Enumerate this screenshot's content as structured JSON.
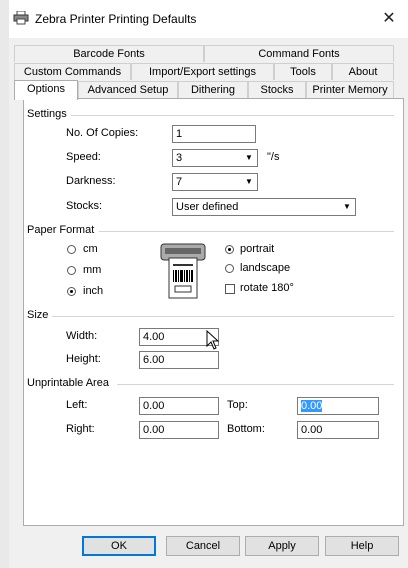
{
  "window": {
    "title": "Zebra Printer Printing Defaults"
  },
  "tabs": {
    "row1": [
      "Barcode Fonts",
      "Command Fonts"
    ],
    "row2": [
      "Custom Commands",
      "Import/Export settings",
      "Tools",
      "About"
    ],
    "row3": [
      "Options",
      "Advanced Setup",
      "Dithering",
      "Stocks",
      "Printer Memory"
    ],
    "active": "Options"
  },
  "settings": {
    "heading": "Settings",
    "copies_label": "No. Of Copies:",
    "copies_value": "1",
    "speed_label": "Speed:",
    "speed_value": "3",
    "speed_unit": "\"/s",
    "darkness_label": "Darkness:",
    "darkness_value": "7",
    "stocks_label": "Stocks:",
    "stocks_value": "User defined"
  },
  "paper_format": {
    "heading": "Paper Format",
    "units": [
      "cm",
      "mm",
      "inch"
    ],
    "selected_unit": "inch",
    "orientations": [
      "portrait",
      "landscape"
    ],
    "selected_orientation": "portrait",
    "rotate_label": "rotate 180°",
    "rotate_checked": false
  },
  "size": {
    "heading": "Size",
    "width_label": "Width:",
    "width_value": "4.00",
    "height_label": "Height:",
    "height_value": "6.00"
  },
  "unprintable_area": {
    "heading": "Unprintable Area",
    "left_label": "Left:",
    "left_value": "0.00",
    "top_label": "Top:",
    "top_value": "0.00",
    "right_label": "Right:",
    "right_value": "0.00",
    "bottom_label": "Bottom:",
    "bottom_value": "0.00"
  },
  "buttons": {
    "ok": "OK",
    "cancel": "Cancel",
    "apply": "Apply",
    "help": "Help"
  }
}
